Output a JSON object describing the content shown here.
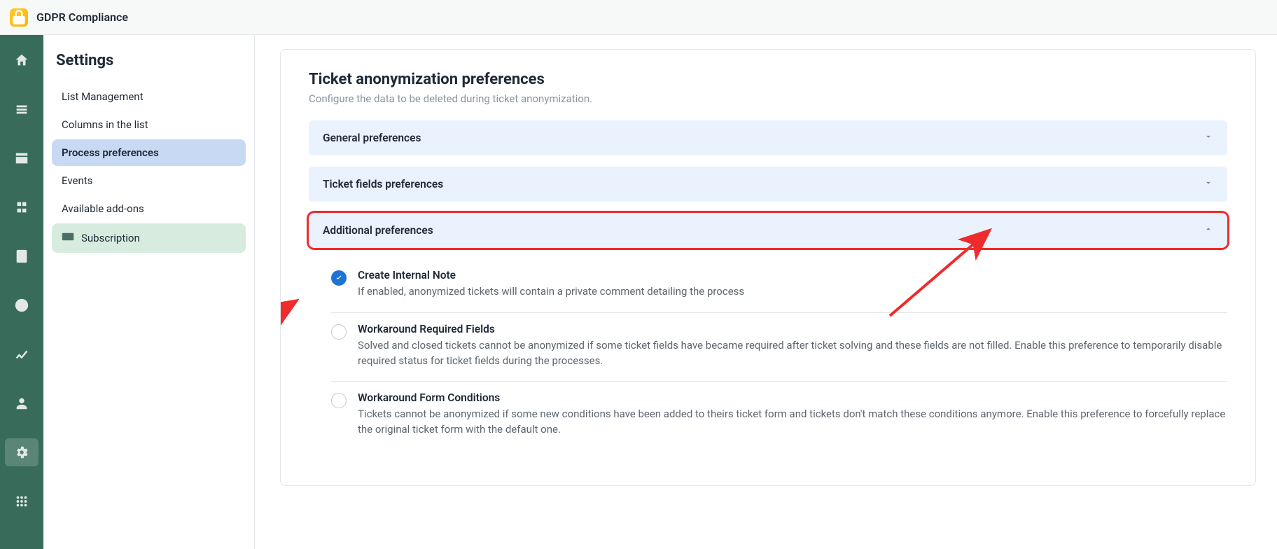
{
  "header": {
    "app_title": "GDPR Compliance"
  },
  "rail": [
    {
      "name": "home-icon"
    },
    {
      "name": "list-icon"
    },
    {
      "name": "columns-icon"
    },
    {
      "name": "process-icon"
    },
    {
      "name": "events-icon"
    },
    {
      "name": "clock-icon"
    },
    {
      "name": "chart-icon"
    },
    {
      "name": "users-icon"
    },
    {
      "name": "settings-icon",
      "active": true
    },
    {
      "name": "apps-icon"
    }
  ],
  "settings": {
    "title": "Settings",
    "items": [
      {
        "label": "List Management"
      },
      {
        "label": "Columns in the list"
      },
      {
        "label": "Process preferences",
        "selected": true
      },
      {
        "label": "Events"
      },
      {
        "label": "Available add-ons"
      },
      {
        "label": "Subscription",
        "subscription": true
      }
    ]
  },
  "main": {
    "title": "Ticket anonymization preferences",
    "subtitle": "Configure the data to be deleted during ticket anonymization.",
    "sections": [
      {
        "label": "General preferences",
        "expanded": false
      },
      {
        "label": "Ticket fields preferences",
        "expanded": false
      },
      {
        "label": "Additional preferences",
        "expanded": true,
        "highlighted": true
      }
    ],
    "additional_prefs": [
      {
        "title": "Create Internal Note",
        "desc": "If enabled, anonymized tickets will contain a private comment detailing the process",
        "checked": true
      },
      {
        "title": "Workaround Required Fields",
        "desc": "Solved and closed tickets cannot be anonymized if some ticket fields have became required after ticket solving and these fields are not filled. Enable this preference to temporarily disable required status for ticket fields during the processes.",
        "checked": false
      },
      {
        "title": "Workaround Form Conditions",
        "desc": "Tickets cannot be anonymized if some new conditions have been added to theirs ticket form and tickets don't match these conditions anymore. Enable this preference to forcefully replace the original ticket form with the default one.",
        "checked": false
      }
    ]
  }
}
